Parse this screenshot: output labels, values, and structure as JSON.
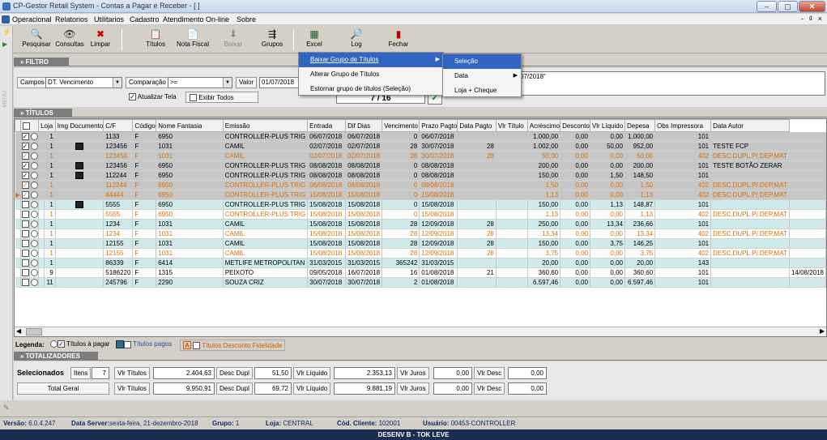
{
  "window": {
    "title": "CP-Gestor Retail System - Contas a Pagar e Receber - [ ]",
    "min": "–",
    "max": "▢",
    "close": "✕"
  },
  "menubar": {
    "items": [
      "Operacional",
      "Relatorios",
      "Utilitarios",
      "Cadastro",
      "Atendimento On-line",
      "Sobre"
    ],
    "mdi": "- ₫ ×"
  },
  "toolbar": {
    "buttons": [
      {
        "label": "Pesquisar",
        "icon": "search-icon",
        "glyph": "🔍"
      },
      {
        "label": "Consultas",
        "icon": "binoculars-icon",
        "glyph": "👁"
      },
      {
        "label": "Limpar",
        "icon": "clear-icon",
        "glyph": "✖"
      },
      {
        "label": "Títulos",
        "icon": "titles-icon",
        "glyph": "📋"
      },
      {
        "label": "Nota Fiscal",
        "icon": "invoice-icon",
        "glyph": "📄"
      },
      {
        "label": "Baixar",
        "icon": "download-icon",
        "glyph": "⬇"
      },
      {
        "label": "Grupos",
        "icon": "groups-icon",
        "glyph": "⇶"
      },
      {
        "label": "Excel",
        "icon": "excel-icon",
        "glyph": "▦"
      },
      {
        "label": "Log",
        "icon": "log-icon",
        "glyph": "🔎"
      },
      {
        "label": "Fechar",
        "icon": "exit-icon",
        "glyph": "▮"
      }
    ]
  },
  "leftstrip": {
    "text": "MENU"
  },
  "filter": {
    "header": "» FILTRO",
    "campos_label": "Campos",
    "campos_value": "DT. Vencimento",
    "comparacao_label": "Comparação",
    "comparacao_value": ">=",
    "valor_label": "Valor",
    "valor_value": "01/07/2018",
    "expr_value": "07/2018\"",
    "atualizar_label": "Atualizar Tela",
    "exibir_label": "Exibir Todos",
    "counter": "7 / 16",
    "check_mark": "✓"
  },
  "grupos_menu": {
    "items": [
      {
        "label": "Baixar Grupo de Títulos",
        "highlight": true,
        "submenu": true
      },
      {
        "label": "Alterar Grupo de Títulos",
        "highlight": false,
        "submenu": false
      },
      {
        "label": "Estornar grupo de títulos (Seleção)",
        "highlight": false,
        "submenu": false
      }
    ]
  },
  "baixar_submenu": {
    "items": [
      {
        "label": "Seleção",
        "highlight": true,
        "submenu": false
      },
      {
        "label": "Data",
        "highlight": false,
        "submenu": true
      },
      {
        "label": "Loja + Cheque",
        "highlight": false,
        "submenu": false
      }
    ]
  },
  "titulos": {
    "header": "» TÍTULOS",
    "columns": [
      "",
      "Loja",
      "Img",
      "Documento",
      "C/F",
      "Código",
      "Nome Fantasia",
      "Emissão",
      "Entrada",
      "Dif Dias",
      "Vencimento",
      "Prazo Pagto",
      "Data Pagto",
      "Vlr Título",
      "Acréscimo",
      "Desconto",
      "Vlr Líquido",
      "Depesa",
      "Obs Impressora",
      "Data Autor"
    ],
    "rows": [
      {
        "chk": true,
        "sel": false,
        "loja": "1",
        "img": false,
        "doc": "1133",
        "cf": "F",
        "cod": "6950",
        "nome": "CONTROLLER-PLUS TRIG",
        "emis": "06/07/2018",
        "entr": "06/07/2018",
        "dif": "0",
        "venc": "06/07/2018",
        "prazo": "",
        "dtpag": "",
        "vlr": "1.000,00",
        "acr": "0,00",
        "desc": "0,00",
        "liq": "1.000,00",
        "dep": "101",
        "obs": "",
        "dtaut": "",
        "bg": "gray",
        "orange": false
      },
      {
        "chk": true,
        "sel": false,
        "loja": "1",
        "img": true,
        "doc": "123456",
        "cf": "F",
        "cod": "1031",
        "nome": "CAMIL",
        "emis": "02/07/2018",
        "entr": "02/07/2018",
        "dif": "28",
        "venc": "30/07/2018",
        "prazo": "28",
        "dtpag": "",
        "vlr": "1.002,00",
        "acr": "0,00",
        "desc": "50,00",
        "liq": "952,00",
        "dep": "101",
        "obs": "TESTE FCP",
        "dtaut": "",
        "bg": "gray",
        "orange": false
      },
      {
        "chk": true,
        "sel": false,
        "loja": "1",
        "img": false,
        "doc": "123456",
        "cf": "F",
        "cod": "1031",
        "nome": "CAMIL",
        "emis": "02/07/2018",
        "entr": "02/07/2018",
        "dif": "28",
        "venc": "30/07/2018",
        "prazo": "28",
        "dtpag": "",
        "vlr": "50,00",
        "acr": "0,00",
        "desc": "0,00",
        "liq": "50,00",
        "dep": "402",
        "obs": "DESC.DUPL.P/.DEP.MAT",
        "dtaut": "",
        "bg": "gray",
        "orange": true
      },
      {
        "chk": true,
        "sel": false,
        "loja": "1",
        "img": true,
        "doc": "123456",
        "cf": "F",
        "cod": "6950",
        "nome": "CONTROLLER-PLUS TRIG",
        "emis": "08/08/2018",
        "entr": "08/08/2018",
        "dif": "0",
        "venc": "08/08/2018",
        "prazo": "",
        "dtpag": "",
        "vlr": "200,00",
        "acr": "0,00",
        "desc": "0,00",
        "liq": "200,00",
        "dep": "101",
        "obs": "TESTE BOTÃO ZERAR",
        "dtaut": "",
        "bg": "gray",
        "orange": false
      },
      {
        "chk": true,
        "sel": false,
        "loja": "1",
        "img": true,
        "doc": "112244",
        "cf": "F",
        "cod": "6950",
        "nome": "CONTROLLER-PLUS TRIG",
        "emis": "08/08/2018",
        "entr": "08/08/2018",
        "dif": "0",
        "venc": "08/08/2018",
        "prazo": "",
        "dtpag": "",
        "vlr": "150,00",
        "acr": "0,00",
        "desc": "1,50",
        "liq": "148,50",
        "dep": "101",
        "obs": "",
        "dtaut": "",
        "bg": "gray",
        "orange": false
      },
      {
        "chk": true,
        "sel": false,
        "loja": "1",
        "img": false,
        "doc": "112244",
        "cf": "F",
        "cod": "6950",
        "nome": "CONTROLLER-PLUS TRIG",
        "emis": "08/08/2018",
        "entr": "08/08/2018",
        "dif": "0",
        "venc": "08/08/2018",
        "prazo": "",
        "dtpag": "",
        "vlr": "1,50",
        "acr": "0,00",
        "desc": "0,00",
        "liq": "1,50",
        "dep": "402",
        "obs": "DESC.DUPL.P/.DEP.MAT",
        "dtaut": "",
        "bg": "gray",
        "orange": true
      },
      {
        "chk": true,
        "sel": true,
        "loja": "1",
        "img": false,
        "doc": "44444",
        "cf": "F",
        "cod": "6950",
        "nome": "CONTROLLER-PLUS TRIG",
        "emis": "15/08/2018",
        "entr": "15/08/2018",
        "dif": "0",
        "venc": "15/08/2018",
        "prazo": "",
        "dtpag": "",
        "vlr": "1,13",
        "acr": "0,00",
        "desc": "0,00",
        "liq": "1,13",
        "dep": "402",
        "obs": "DESC.DUPL.P/.DEP.MAT",
        "dtaut": "",
        "bg": "gray",
        "orange": true
      },
      {
        "chk": false,
        "sel": false,
        "loja": "1",
        "img": true,
        "doc": "5555",
        "cf": "F",
        "cod": "6950",
        "nome": "CONTROLLER-PLUS TRIG",
        "emis": "15/08/2018",
        "entr": "15/08/2018",
        "dif": "0",
        "venc": "15/08/2018",
        "prazo": "",
        "dtpag": "",
        "vlr": "150,00",
        "acr": "0,00",
        "desc": "1,13",
        "liq": "148,87",
        "dep": "101",
        "obs": "",
        "dtaut": "",
        "bg": "teal",
        "orange": false
      },
      {
        "chk": false,
        "sel": false,
        "loja": "1",
        "img": false,
        "doc": "5555",
        "cf": "F",
        "cod": "6950",
        "nome": "CONTROLLER-PLUS TRIG",
        "emis": "15/08/2018",
        "entr": "15/08/2018",
        "dif": "0",
        "venc": "15/08/2018",
        "prazo": "",
        "dtpag": "",
        "vlr": "1,13",
        "acr": "0,00",
        "desc": "0,00",
        "liq": "1,13",
        "dep": "402",
        "obs": "DESC.DUPL.P/.DEP.MAT",
        "dtaut": "",
        "bg": "white",
        "orange": true
      },
      {
        "chk": false,
        "sel": false,
        "loja": "1",
        "img": false,
        "doc": "1234",
        "cf": "F",
        "cod": "1031",
        "nome": "CAMIL",
        "emis": "15/08/2018",
        "entr": "15/08/2018",
        "dif": "28",
        "venc": "12/09/2018",
        "prazo": "28",
        "dtpag": "",
        "vlr": "250,00",
        "acr": "0,00",
        "desc": "13,34",
        "liq": "236,66",
        "dep": "101",
        "obs": "",
        "dtaut": "",
        "bg": "teal",
        "orange": false
      },
      {
        "chk": false,
        "sel": false,
        "loja": "1",
        "img": false,
        "doc": "1234",
        "cf": "F",
        "cod": "1031",
        "nome": "CAMIL",
        "emis": "15/08/2018",
        "entr": "15/08/2018",
        "dif": "28",
        "venc": "12/09/2018",
        "prazo": "28",
        "dtpag": "",
        "vlr": "13,34",
        "acr": "0,00",
        "desc": "0,00",
        "liq": "13,34",
        "dep": "402",
        "obs": "DESC.DUPL.P/.DEP.MAT",
        "dtaut": "",
        "bg": "white",
        "orange": true
      },
      {
        "chk": false,
        "sel": false,
        "loja": "1",
        "img": false,
        "doc": "12155",
        "cf": "F",
        "cod": "1031",
        "nome": "CAMIL",
        "emis": "15/08/2018",
        "entr": "15/08/2018",
        "dif": "28",
        "venc": "12/09/2018",
        "prazo": "28",
        "dtpag": "",
        "vlr": "150,00",
        "acr": "0,00",
        "desc": "3,75",
        "liq": "146,25",
        "dep": "101",
        "obs": "",
        "dtaut": "",
        "bg": "teal",
        "orange": false
      },
      {
        "chk": false,
        "sel": false,
        "loja": "1",
        "img": false,
        "doc": "12155",
        "cf": "F",
        "cod": "1031",
        "nome": "CAMIL",
        "emis": "15/08/2018",
        "entr": "15/08/2018",
        "dif": "28",
        "venc": "12/09/2018",
        "prazo": "28",
        "dtpag": "",
        "vlr": "3,75",
        "acr": "0,00",
        "desc": "0,00",
        "liq": "3,75",
        "dep": "402",
        "obs": "DESC.DUPL.P/.DEP.MAT",
        "dtaut": "",
        "bg": "white",
        "orange": true
      },
      {
        "chk": false,
        "sel": false,
        "loja": "1",
        "img": false,
        "doc": "86339",
        "cf": "F",
        "cod": "6414",
        "nome": "METLIFE METROPOLITAN",
        "emis": "31/03/2015",
        "entr": "31/03/2015",
        "dif": "365242",
        "venc": "31/03/2015",
        "prazo": "",
        "dtpag": "",
        "vlr": "20,00",
        "acr": "0,00",
        "desc": "0,00",
        "liq": "20,00",
        "dep": "143",
        "obs": "",
        "dtaut": "",
        "bg": "teal",
        "orange": false
      },
      {
        "chk": false,
        "sel": false,
        "loja": "9",
        "img": false,
        "doc": "5186220",
        "cf": "F",
        "cod": "1315",
        "nome": "PEIXOTO",
        "emis": "09/05/2018",
        "entr": "16/07/2018",
        "dif": "16",
        "venc": "01/08/2018",
        "prazo": "21",
        "dtpag": "",
        "vlr": "360,60",
        "acr": "0,00",
        "desc": "0,00",
        "liq": "360,60",
        "dep": "101",
        "obs": "",
        "dtaut": "14/08/2018",
        "bg": "white",
        "orange": false
      },
      {
        "chk": false,
        "sel": false,
        "loja": "11",
        "img": false,
        "doc": "245796",
        "cf": "F",
        "cod": "2290",
        "nome": "SOUZA CRIZ",
        "emis": "30/07/2018",
        "entr": "30/07/2018",
        "dif": "2",
        "venc": "01/08/2018",
        "prazo": "",
        "dtpag": "",
        "vlr": "6.597,46",
        "acr": "0,00",
        "desc": "0,00",
        "liq": "6.597,46",
        "dep": "101",
        "obs": "",
        "dtaut": "",
        "bg": "teal",
        "orange": false
      }
    ]
  },
  "legend": {
    "label": "Legenda:",
    "a_pagar": "Títulos à pagar",
    "pagos": "Títulos pagos",
    "desconto_badge": "A",
    "desconto": "Títulos Desconto Fidelidade"
  },
  "totalizadores": {
    "header": "» TOTALIZADORES",
    "sel_label": "Selecionados",
    "itens_label": "Itens",
    "itens_value": "7",
    "total_label": "Total Geral",
    "vlr_titulos": "Vlr Títulos",
    "desc_dupl": "Desc Dupl",
    "vlr_liquido": "Vlr Líquido",
    "vlr_juros": "Vlr Juros",
    "vlr_desc": "Vlr Desc",
    "sel": {
      "titulos": "2.404,63",
      "dupl": "51,50",
      "liquido": "2.353,13",
      "juros": "0,00",
      "desc": "0,00"
    },
    "total": {
      "titulos": "9.950,91",
      "dupl": "69,72",
      "liquido": "9.881,19",
      "juros": "0,00",
      "desc": "0,00"
    }
  },
  "status": {
    "versao_label": "Versão:",
    "versao": "6.0.4.247",
    "server_label": "Data Server:",
    "server": "sexta-feira, 21-dezembro-2018",
    "grupo_label": "Grupo:",
    "grupo": "1",
    "loja_label": "Loja:",
    "loja": "CENTRAL",
    "cliente_label": "Cód. Cliente:",
    "cliente": "102001",
    "usuario_label": "Usuário:",
    "usuario": "00453-CONTROLLER"
  },
  "footer": {
    "text": "DESENV B - TOK LEVE"
  }
}
